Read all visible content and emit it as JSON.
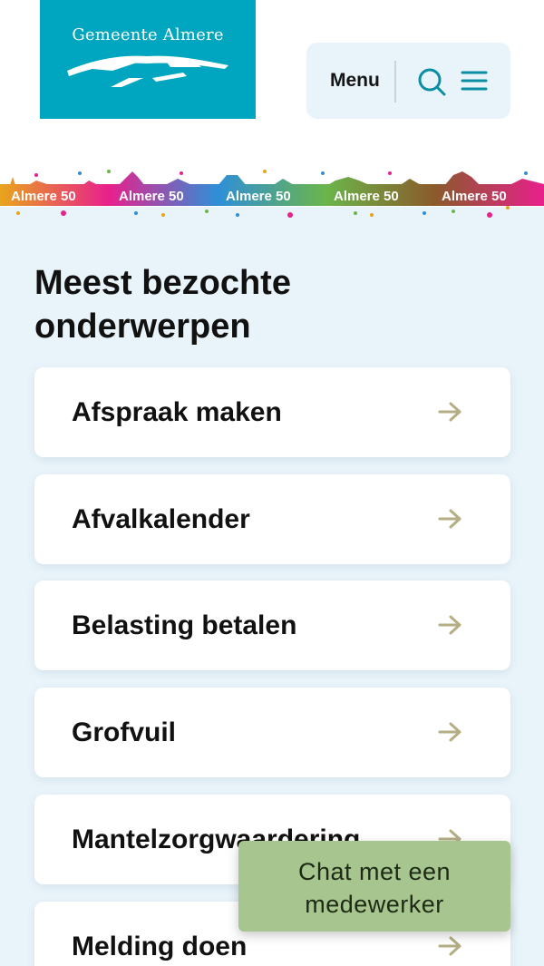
{
  "header": {
    "logo_text": "Gemeente Almere",
    "menu_label": "Menu",
    "icons": {
      "search": "search-icon",
      "menu": "hamburger-icon"
    },
    "colors": {
      "logo_bg": "#00a6bf",
      "nav_bg": "#e9f4fa",
      "accent": "#0b8ea3"
    }
  },
  "banner": {
    "label": "Almere 50",
    "segments": [
      "Almere 50",
      "Almere 50",
      "Almere 50",
      "Almere 50",
      "Almere 50"
    ],
    "colors": [
      "#e8a51c",
      "#e8208c",
      "#2f8fd8",
      "#6bb54a",
      "#8b5a2b"
    ]
  },
  "main": {
    "title": "Meest bezochte onderwerpen",
    "topics": [
      {
        "label": "Afspraak maken"
      },
      {
        "label": "Afvalkalender"
      },
      {
        "label": "Belasting betalen"
      },
      {
        "label": "Grofvuil"
      },
      {
        "label": "Mantelzorgwaardering"
      },
      {
        "label": "Melding doen"
      }
    ],
    "arrow_icon": "arrow-right-icon",
    "arrow_color": "#b3ae84"
  },
  "chat": {
    "label": "Chat met een medewerker",
    "color": "#a7c58f"
  }
}
